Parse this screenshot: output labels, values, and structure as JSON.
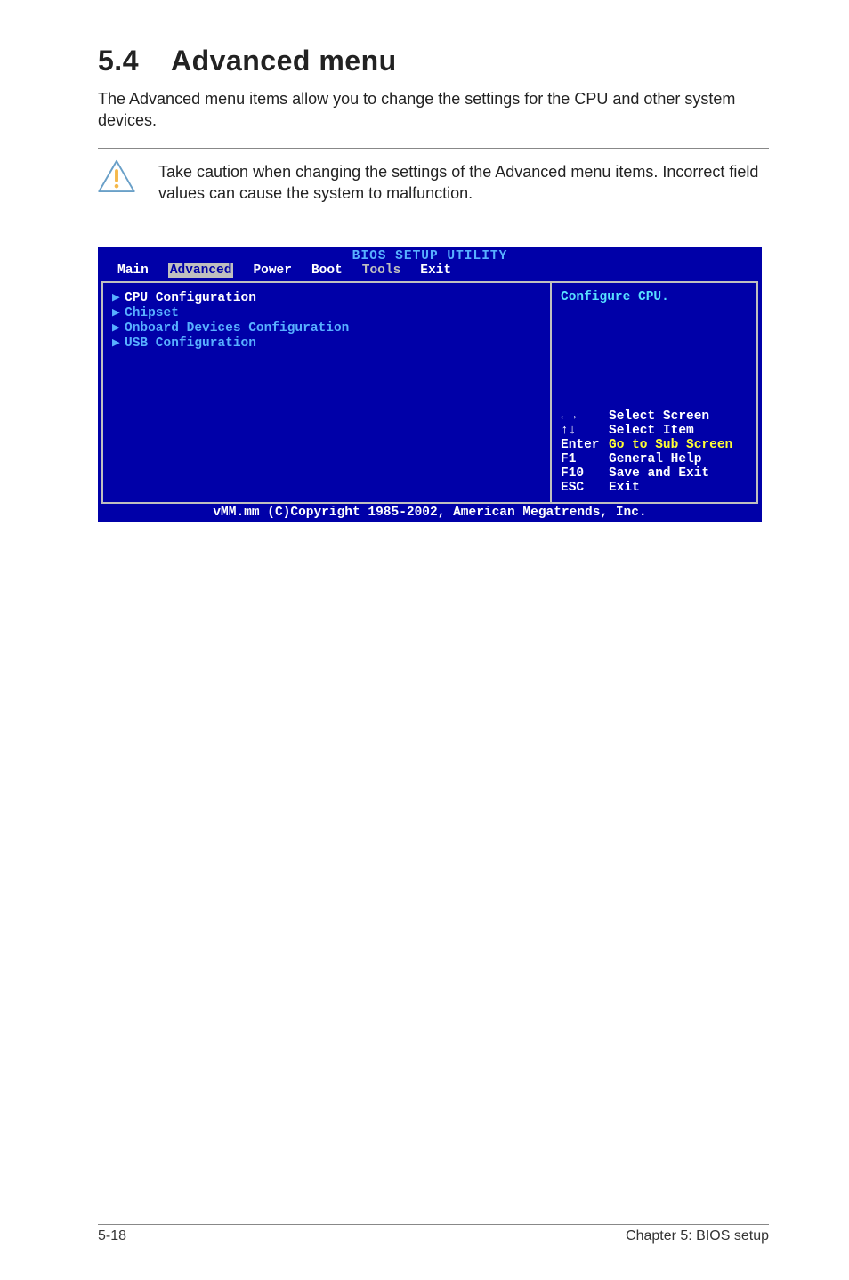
{
  "heading": {
    "number": "5.4",
    "title": "Advanced menu"
  },
  "intro": "The Advanced menu items allow you to change the settings for the CPU and other system devices.",
  "note": "Take caution when changing the settings of the Advanced menu items. Incorrect field values can cause the system to malfunction.",
  "bios": {
    "title": "BIOS SETUP UTILITY",
    "tabs": [
      "Main",
      "Advanced",
      "Power",
      "Boot",
      "Tools",
      "Exit"
    ],
    "active_tab": "Advanced",
    "grey_tabs": [
      "Tools"
    ],
    "menu": [
      {
        "label": "CPU Configuration",
        "selected": true
      },
      {
        "label": "Chipset",
        "selected": false
      },
      {
        "label": "Onboard Devices Configuration",
        "selected": false
      },
      {
        "label": "USB Configuration",
        "selected": false
      }
    ],
    "help_text": "Configure CPU.",
    "keys": [
      {
        "key": "←→",
        "desc": "Select Screen",
        "yellow": false
      },
      {
        "key": "↑↓",
        "desc": "Select Item",
        "yellow": false
      },
      {
        "key": "Enter",
        "desc": "Go to Sub Screen",
        "yellow": true
      },
      {
        "key": "F1",
        "desc": "General Help",
        "yellow": false
      },
      {
        "key": "F10",
        "desc": "Save and Exit",
        "yellow": false
      },
      {
        "key": "ESC",
        "desc": "Exit",
        "yellow": false
      }
    ],
    "footer": "vMM.mm (C)Copyright 1985-2002, American Megatrends, Inc."
  },
  "doc_footer": {
    "left": "5-18",
    "right": "Chapter 5: BIOS setup"
  }
}
